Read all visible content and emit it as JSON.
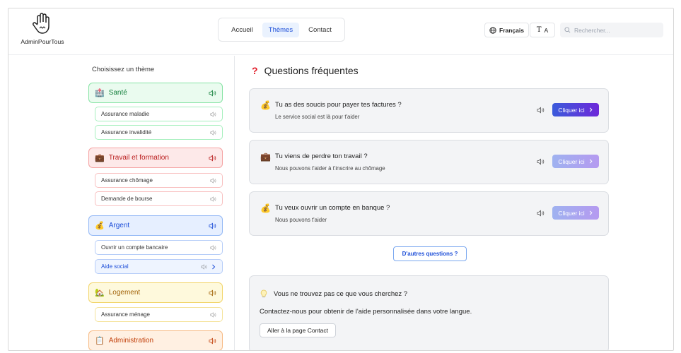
{
  "app": {
    "name": "AdminPourTous"
  },
  "nav": {
    "items": [
      {
        "label": "Accueil",
        "active": false
      },
      {
        "label": "Thèmes",
        "active": true
      },
      {
        "label": "Contact",
        "active": false
      }
    ]
  },
  "header": {
    "language": "Français",
    "font_size_small": "T",
    "font_size_big": "A",
    "search_placeholder": "Rechercher..."
  },
  "sidebar": {
    "title": "Choisissez un thème",
    "themes": [
      {
        "label": "Santé",
        "emoji": "🏥",
        "color": "green",
        "subs": [
          {
            "label": "Assurance maladie"
          },
          {
            "label": "Assurance invalidité"
          }
        ]
      },
      {
        "label": "Travail et formation",
        "emoji": "💼",
        "color": "red",
        "subs": [
          {
            "label": "Assurance chômage"
          },
          {
            "label": "Demande de bourse"
          }
        ]
      },
      {
        "label": "Argent",
        "emoji": "💰",
        "color": "blue",
        "subs": [
          {
            "label": "Ouvrir un compte bancaire"
          },
          {
            "label": "Aide social",
            "active": true
          }
        ]
      },
      {
        "label": "Logement",
        "emoji": "🏡",
        "color": "yellow",
        "subs": [
          {
            "label": "Assurance ménage"
          }
        ]
      },
      {
        "label": "Administration",
        "emoji": "📋",
        "color": "orange",
        "subs": []
      }
    ]
  },
  "main": {
    "title": "Questions fréquentes",
    "title_icon": "?",
    "faqs": [
      {
        "emoji": "💰",
        "question": "Tu as des soucis pour payer tes factures ?",
        "answer": "Le service social est là pour t'aider",
        "cta": "Cliquer ici",
        "cta_style": "strong"
      },
      {
        "emoji": "💼",
        "question": "Tu viens de perdre ton travail ?",
        "answer": "Nous pouvons t'aider à t'inscrire au chômage",
        "cta": "Cliquer ici",
        "cta_style": "light"
      },
      {
        "emoji": "💰",
        "question": "Tu veux ouvrir un compte en banque ?",
        "answer": "Nous pouvons t'aider",
        "cta": "Cliquer ici",
        "cta_style": "light"
      }
    ],
    "more_questions": "D'autres questions ?",
    "contact": {
      "title": "Vous ne trouvez pas ce que vous cherchez ?",
      "text": "Contactez-nous pour obtenir de l'aide personnalisée dans votre langue.",
      "button": "Aller à la page Contact"
    }
  },
  "icons": {
    "logo": "hand-icon",
    "globe": "globe-icon",
    "search": "search-icon",
    "speaker": "speaker-icon",
    "chevron": "chevron-right-icon",
    "bulb": "lightbulb-icon"
  }
}
